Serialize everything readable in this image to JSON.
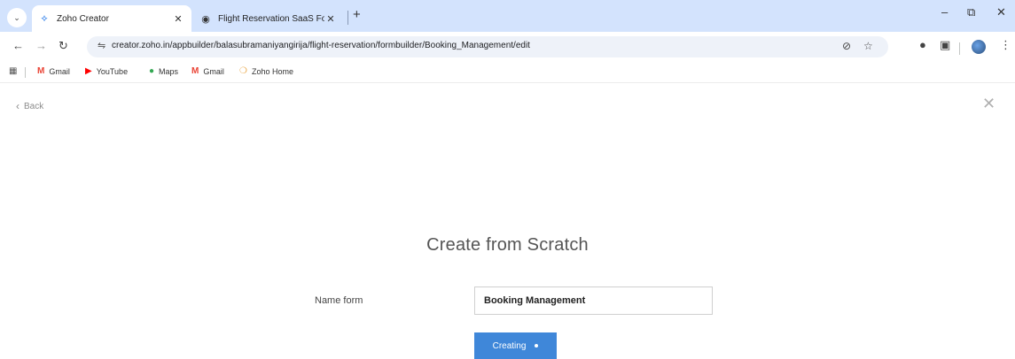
{
  "browser": {
    "tabs": [
      {
        "title": "Zoho Creator",
        "active": true
      },
      {
        "title": "Flight Reservation SaaS Forms",
        "active": false
      }
    ],
    "address_bar": {
      "url": "creator.zoho.in/appbuilder/balasubramaniyangirija/flight-reservation/formbuilder/Booking_Management/edit"
    },
    "bookmarks": [
      {
        "label": "Gmail",
        "icon": "gmail-icon",
        "color": "#ea4335"
      },
      {
        "label": "YouTube",
        "icon": "youtube-icon",
        "color": "#ff0000"
      },
      {
        "label": "Maps",
        "icon": "maps-icon",
        "color": "#34a853"
      },
      {
        "label": "Gmail",
        "icon": "gmail-icon",
        "color": "#ea4335"
      },
      {
        "label": "Zoho Home",
        "icon": "zoho-icon",
        "color": "#e8a33d"
      }
    ]
  },
  "page": {
    "back_label": "Back",
    "heading": "Create from Scratch",
    "form_name_label": "Name form",
    "form_name_value": "Booking Management",
    "submit_label": "Creating",
    "accent_color": "#3f87d9"
  }
}
